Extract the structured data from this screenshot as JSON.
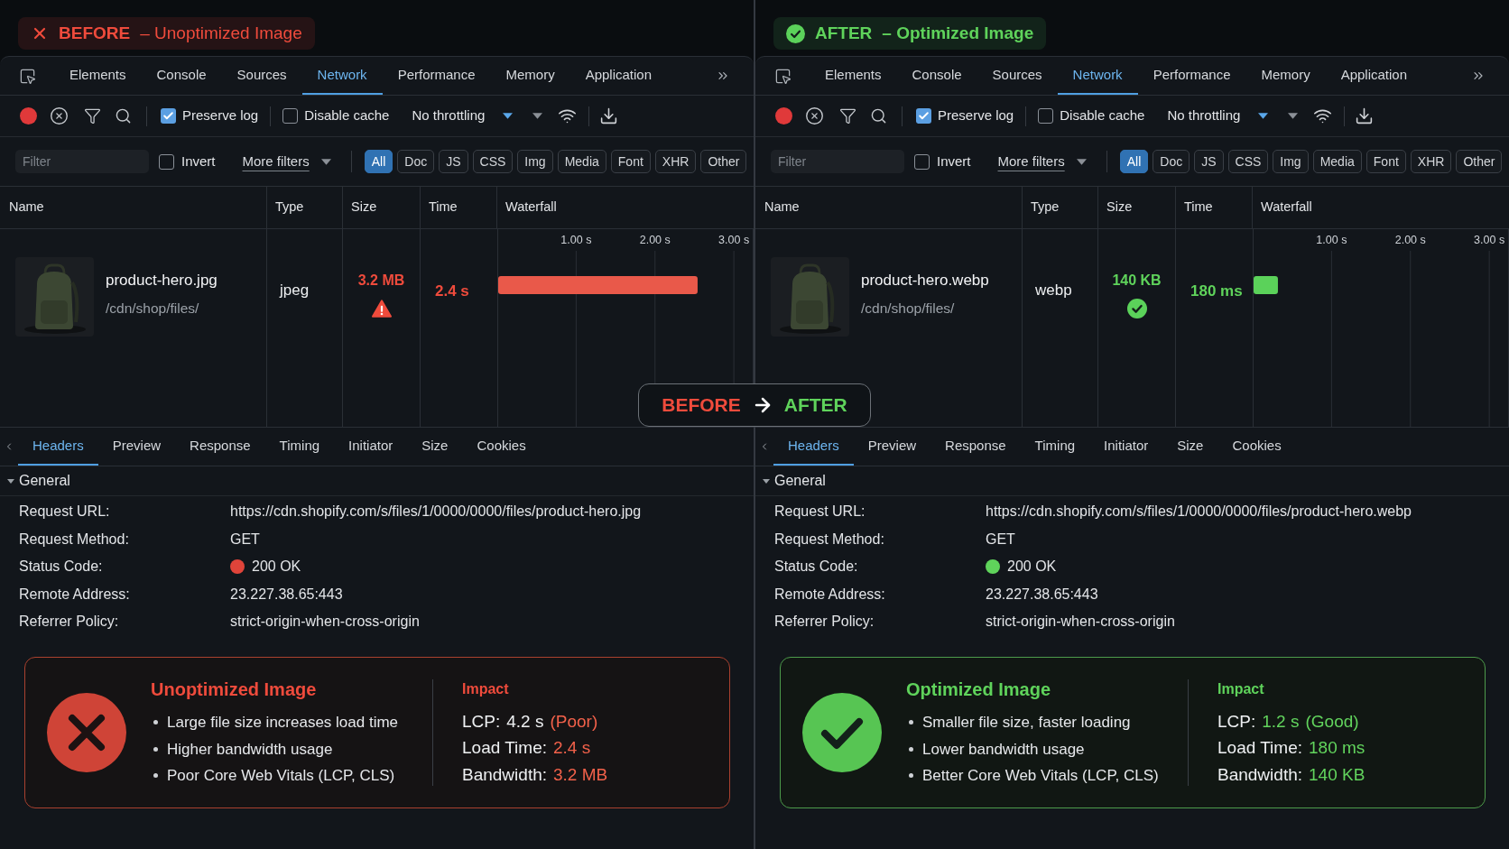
{
  "panels": [
    {
      "kind": "bad",
      "badge": {
        "label": "BEFORE",
        "subtitle": "– Unoptimized Image"
      },
      "tabs": [
        {
          "label": "Elements",
          "selected": false
        },
        {
          "label": "Console",
          "selected": false
        },
        {
          "label": "Sources",
          "selected": false
        },
        {
          "label": "Network",
          "selected": true
        },
        {
          "label": "Performance",
          "selected": false
        },
        {
          "label": "Memory",
          "selected": false
        },
        {
          "label": "Application",
          "selected": false
        }
      ],
      "toolbar": {
        "recording": true,
        "checkboxes": [
          {
            "label": "Preserve log",
            "checked": true
          },
          {
            "label": "Disable cache",
            "checked": false
          }
        ],
        "throttling": "No throttling"
      },
      "filter_bar": {
        "placeholder": "Filter",
        "invert": {
          "label": "Invert",
          "checked": false
        },
        "more_filters": "More filters",
        "types": [
          {
            "label": "All",
            "selected": true
          },
          {
            "label": "Doc",
            "selected": false
          },
          {
            "label": "JS",
            "selected": false
          },
          {
            "label": "CSS",
            "selected": false
          },
          {
            "label": "Img",
            "selected": false
          },
          {
            "label": "Media",
            "selected": false
          },
          {
            "label": "Font",
            "selected": false
          },
          {
            "label": "XHR",
            "selected": false
          },
          {
            "label": "Other",
            "selected": false
          }
        ]
      },
      "table": {
        "columns": [
          "Name",
          "Type",
          "Size",
          "Time",
          "Waterfall"
        ],
        "rows": [
          {
            "name": "product-hero.jpg",
            "path": "/cdn/shop/files/",
            "type": "jpeg",
            "size": "3.2 MB",
            "time": "2.4 s",
            "chart_data": {
              "type": "bar",
              "orientation": "horizontal",
              "values": [
                2.54
              ],
              "xlim": [
                0,
                3.25
              ],
              "xticks": [
                {
                  "value": 1,
                  "label": "1.00 s"
                },
                {
                  "value": 2,
                  "label": "2.00 s"
                },
                {
                  "value": 3,
                  "label": "3.00 s"
                }
              ],
              "grid": true
            }
          }
        ]
      },
      "detail_tabs": [
        {
          "label": "Headers",
          "selected": true
        },
        {
          "label": "Preview",
          "selected": false
        },
        {
          "label": "Response",
          "selected": false
        },
        {
          "label": "Timing",
          "selected": false
        },
        {
          "label": "Initiator",
          "selected": false
        },
        {
          "label": "Size",
          "selected": false
        },
        {
          "label": "Cookies",
          "selected": false
        }
      ],
      "general": {
        "title": "General",
        "expanded": true,
        "fields": [
          {
            "label": "Request URL:",
            "value": "https://cdn.shopify.com/s/files/1/0000/0000/files/product-hero.jpg"
          },
          {
            "label": "Request Method:",
            "value": "GET"
          },
          {
            "label": "Status Code:",
            "value": "200 OK",
            "color": "#e0443a"
          },
          {
            "label": "Remote Address:",
            "value": "23.227.38.65:443"
          },
          {
            "label": "Referrer Policy:",
            "value": "strict-origin-when-cross-origin"
          }
        ]
      },
      "summary": {
        "title": "Unoptimized Image",
        "points": [
          "Large file size increases load time",
          "Higher bandwidth usage",
          "Poor Core Web Vitals (LCP, CLS)"
        ],
        "impact_title": "Impact",
        "metrics": [
          {
            "label": "LCP:",
            "value": "4.2 s",
            "highlighted": false,
            "rating": "(Poor)"
          },
          {
            "label": "Load Time:",
            "value": "2.4 s",
            "highlighted": true
          },
          {
            "label": "Bandwidth:",
            "value": "3.2 MB",
            "highlighted": true
          }
        ]
      }
    },
    {
      "kind": "good",
      "badge": {
        "label": "AFTER",
        "subtitle": "– Optimized Image"
      },
      "tabs": [
        {
          "label": "Elements",
          "selected": false
        },
        {
          "label": "Console",
          "selected": false
        },
        {
          "label": "Sources",
          "selected": false
        },
        {
          "label": "Network",
          "selected": true
        },
        {
          "label": "Performance",
          "selected": false
        },
        {
          "label": "Memory",
          "selected": false
        },
        {
          "label": "Application",
          "selected": false
        }
      ],
      "toolbar": {
        "recording": true,
        "checkboxes": [
          {
            "label": "Preserve log",
            "checked": true
          },
          {
            "label": "Disable cache",
            "checked": false
          }
        ],
        "throttling": "No throttling"
      },
      "filter_bar": {
        "placeholder": "Filter",
        "invert": {
          "label": "Invert",
          "checked": false
        },
        "more_filters": "More filters",
        "types": [
          {
            "label": "All",
            "selected": true
          },
          {
            "label": "Doc",
            "selected": false
          },
          {
            "label": "JS",
            "selected": false
          },
          {
            "label": "CSS",
            "selected": false
          },
          {
            "label": "Img",
            "selected": false
          },
          {
            "label": "Media",
            "selected": false
          },
          {
            "label": "Font",
            "selected": false
          },
          {
            "label": "XHR",
            "selected": false
          },
          {
            "label": "Other",
            "selected": false
          }
        ]
      },
      "table": {
        "columns": [
          "Name",
          "Type",
          "Size",
          "Time",
          "Waterfall"
        ],
        "rows": [
          {
            "name": "product-hero.webp",
            "path": "/cdn/shop/files/",
            "type": "webp",
            "size": "140 KB",
            "time": "180 ms",
            "chart_data": {
              "type": "bar",
              "orientation": "horizontal",
              "values": [
                0.32
              ],
              "xlim": [
                0,
                3.25
              ],
              "xticks": [
                {
                  "value": 1,
                  "label": "1.00 s"
                },
                {
                  "value": 2,
                  "label": "2.00 s"
                },
                {
                  "value": 3,
                  "label": "3.00 s"
                }
              ],
              "grid": true
            }
          }
        ]
      },
      "detail_tabs": [
        {
          "label": "Headers",
          "selected": true
        },
        {
          "label": "Preview",
          "selected": false
        },
        {
          "label": "Response",
          "selected": false
        },
        {
          "label": "Timing",
          "selected": false
        },
        {
          "label": "Initiator",
          "selected": false
        },
        {
          "label": "Size",
          "selected": false
        },
        {
          "label": "Cookies",
          "selected": false
        }
      ],
      "general": {
        "title": "General",
        "expanded": true,
        "fields": [
          {
            "label": "Request URL:",
            "value": "https://cdn.shopify.com/s/files/1/0000/0000/files/product-hero.webp"
          },
          {
            "label": "Request Method:",
            "value": "GET"
          },
          {
            "label": "Status Code:",
            "value": "200 OK",
            "color": "#5fd35b"
          },
          {
            "label": "Remote Address:",
            "value": "23.227.38.65:443"
          },
          {
            "label": "Referrer Policy:",
            "value": "strict-origin-when-cross-origin"
          }
        ]
      },
      "summary": {
        "title": "Optimized Image",
        "points": [
          "Smaller file size, faster loading",
          "Lower bandwidth usage",
          "Better Core Web Vitals (LCP, CLS)"
        ],
        "impact_title": "Impact",
        "metrics": [
          {
            "label": "LCP:",
            "value": "1.2 s",
            "highlighted": true,
            "rating": "(Good)"
          },
          {
            "label": "Load Time:",
            "value": "180 ms",
            "highlighted": true
          },
          {
            "label": "Bandwidth:",
            "value": "140 KB",
            "highlighted": true
          }
        ]
      }
    }
  ],
  "comparison": {
    "from": "BEFORE",
    "to": "AFTER"
  }
}
